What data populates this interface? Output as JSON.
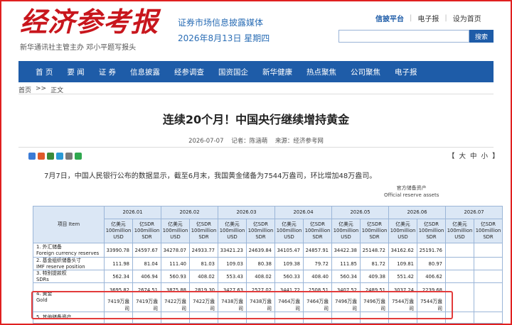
{
  "header": {
    "logo": "经济参考报",
    "logo_sub": "新华通讯社主管主办  邓小平题写报头",
    "slogan": "证券市场信息披露媒体",
    "date": "2026年8月13日 星期四",
    "links": [
      "信披平台",
      "电子报",
      "设为首页"
    ],
    "search_placeholder": "",
    "search_button": "搜索"
  },
  "nav": [
    "首 页",
    "要 闻",
    "证 券",
    "信息披露",
    "经参调查",
    "国资国企",
    "新华健康",
    "热点聚焦",
    "公司聚焦",
    "电子报"
  ],
  "breadcrumb": [
    "首页",
    ">>",
    "正文"
  ],
  "article": {
    "title": "连续20个月！中国央行继续增持黄金",
    "date": "2026-07-07",
    "reporter": "记者：陈涵萌",
    "source": "来源：经济参考网",
    "font_size_label": "【大 中 小】",
    "font_sizes": [
      "【",
      "大",
      "中",
      "小",
      "】"
    ],
    "paragraph": "7月7日，中国人民银行公布的数据显示，截至6月末，我国黄金储备为7544万盎司，环比增加48万盎司。"
  },
  "share_colors": [
    "#3b7bd6",
    "#e05a2a",
    "#3a8a3a",
    "#2a9ad6",
    "#7a7a7a",
    "#2fa84f"
  ],
  "table": {
    "caption": [
      "官方储备资产",
      "Official reserve assets"
    ],
    "item_header": "项目 Item",
    "months": [
      "2026.01",
      "2026.02",
      "2026.03",
      "2026.04",
      "2026.05",
      "2026.06",
      "2026.07"
    ],
    "unit_usd": [
      "亿美元",
      "100million",
      "USD"
    ],
    "unit_sdr": [
      "亿SDR",
      "100million",
      "SDR"
    ],
    "rows": [
      {
        "label": [
          "1. 外汇储备",
          "Foreign currency reserves"
        ],
        "values": [
          "33990.78",
          "24597.67",
          "34278.07",
          "24933.77",
          "33421.23",
          "24639.84",
          "34105.47",
          "24857.91",
          "34422.38",
          "25148.72",
          "34162.62",
          "25191.76"
        ]
      },
      {
        "label": [
          "2. 基金组织储备头寸",
          "IMF reserve position"
        ],
        "values": [
          "111.98",
          "81.04",
          "111.40",
          "81.03",
          "109.03",
          "80.38",
          "109.38",
          "79.72",
          "111.85",
          "81.72",
          "109.81",
          "80.97"
        ]
      },
      {
        "label": [
          "3. 特别提款权",
          "SDRs"
        ],
        "values": [
          "562.34",
          "406.94",
          "560.93",
          "408.02",
          "553.43",
          "408.02",
          "560.33",
          "408.40",
          "560.34",
          "409.38",
          "551.42",
          "406.62"
        ]
      },
      {
        "label": [
          "4. 黄金",
          "Gold"
        ],
        "values": [
          "3695.82",
          "2674.51",
          "3875.88",
          "2819.30",
          "3427.63",
          "2527.02",
          "3441.72",
          "2508.51",
          "3407.52",
          "2489.51",
          "3037.24",
          "2239.68"
        ]
      }
    ],
    "gold_oz": [
      "7419万盎司",
      "7419万盎司",
      "7422万盎司",
      "7422万盎司",
      "7438万盎司",
      "7438万盎司",
      "7464万盎司",
      "7464万盎司",
      "7496万盎司",
      "7496万盎司",
      "7544万盎司",
      "7544万盎司"
    ],
    "next_row_label": "5. 其他储备资产"
  }
}
